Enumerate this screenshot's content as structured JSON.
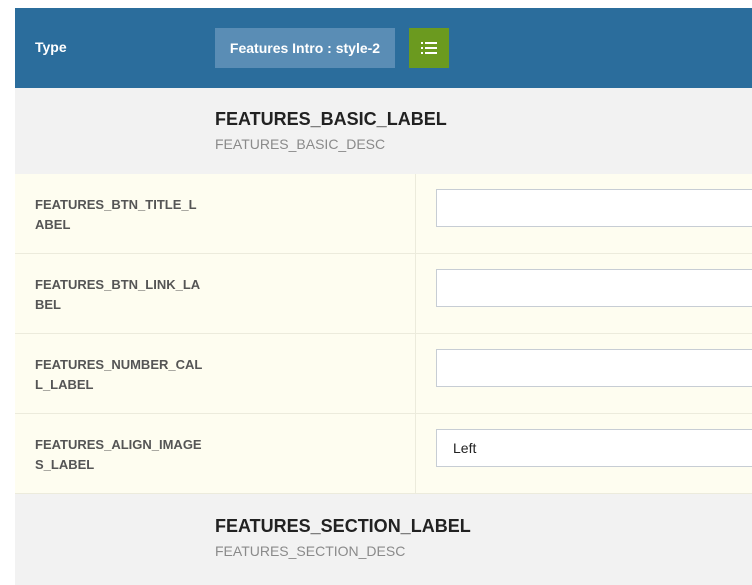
{
  "type_bar": {
    "label": "Type",
    "style_button_label": "Features Intro : style-2",
    "list_icon": "list-icon",
    "color": "#2b6d9c",
    "style_button_color": "#5a8db5",
    "list_button_color": "#6b9a1f"
  },
  "basic_section": {
    "title": "FEATURES_BASIC_LABEL",
    "description": "FEATURES_BASIC_DESC"
  },
  "fields": [
    {
      "label": "FEATURES_BTN_TITLE_LABEL",
      "value": "",
      "type": "text"
    },
    {
      "label": "FEATURES_BTN_LINK_LABEL",
      "value": "",
      "type": "text"
    },
    {
      "label": "FEATURES_NUMBER_CALL_LABEL",
      "value": "",
      "type": "text"
    },
    {
      "label": "FEATURES_ALIGN_IMAGES_LABEL",
      "value": "Left",
      "type": "select"
    }
  ],
  "section_section": {
    "title": "FEATURES_SECTION_LABEL",
    "description": "FEATURES_SECTION_DESC"
  }
}
